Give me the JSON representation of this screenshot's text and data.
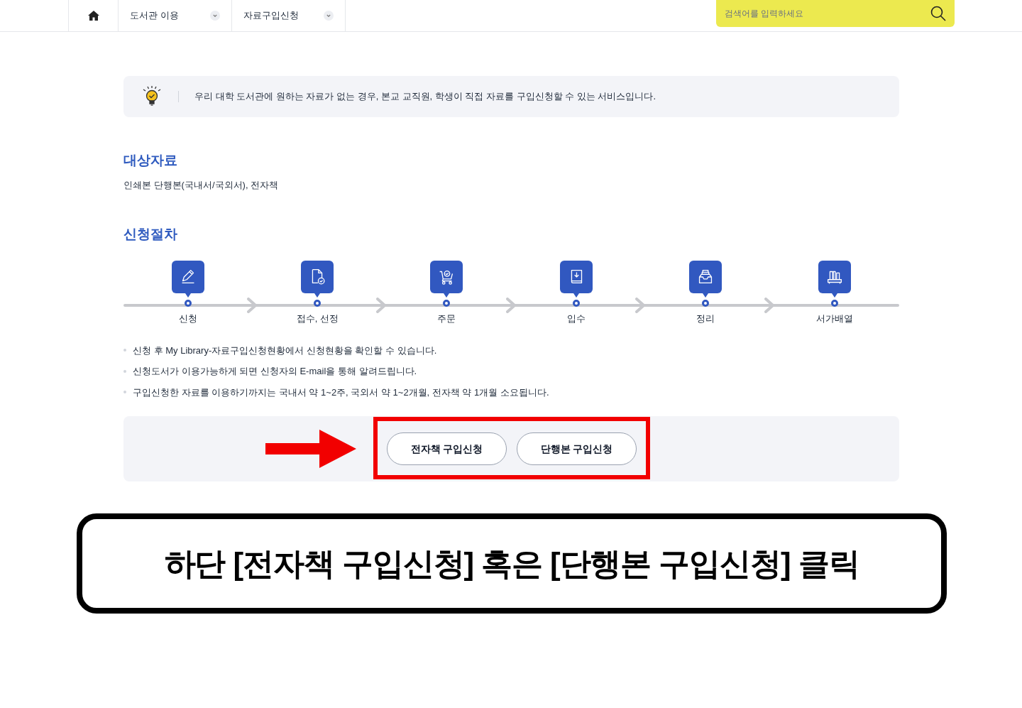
{
  "nav": {
    "items": [
      {
        "kind": "home"
      },
      {
        "kind": "menu",
        "label": "도서관 이용"
      },
      {
        "kind": "menu",
        "label": "자료구입신청"
      }
    ],
    "search": {
      "placeholder": "검색어를 입력하세요"
    }
  },
  "notice": "우리 대학 도서관에 원하는 자료가 없는 경우, 본교 교직원, 학생이 직접 자료를 구입신청할 수 있는 서비스입니다.",
  "target": {
    "heading": "대상자료",
    "text": "인쇄본 단행본(국내서/국외서), 전자책"
  },
  "procedure": {
    "heading": "신청절차",
    "steps": [
      {
        "label": "신청"
      },
      {
        "label": "접수, 선정"
      },
      {
        "label": "주문"
      },
      {
        "label": "입수"
      },
      {
        "label": "정리"
      },
      {
        "label": "서가배열"
      }
    ],
    "notes": [
      "신청 후 My Library-자료구입신청현황에서 신청현황을 확인할 수 있습니다.",
      "신청도서가 이용가능하게 되면 신청자의 E-mail을 통해 알려드립니다.",
      "구입신청한 자료를 이용하기까지는 국내서 약 1~2주, 국외서 약 1~2개월, 전자책 약 1개월 소요됩니다."
    ]
  },
  "buttons": [
    "전자책 구입신청",
    "단행본 구입신청"
  ],
  "annotation": "하단 [전자책 구입신청] 혹은 [단행본 구입신청] 클릭"
}
